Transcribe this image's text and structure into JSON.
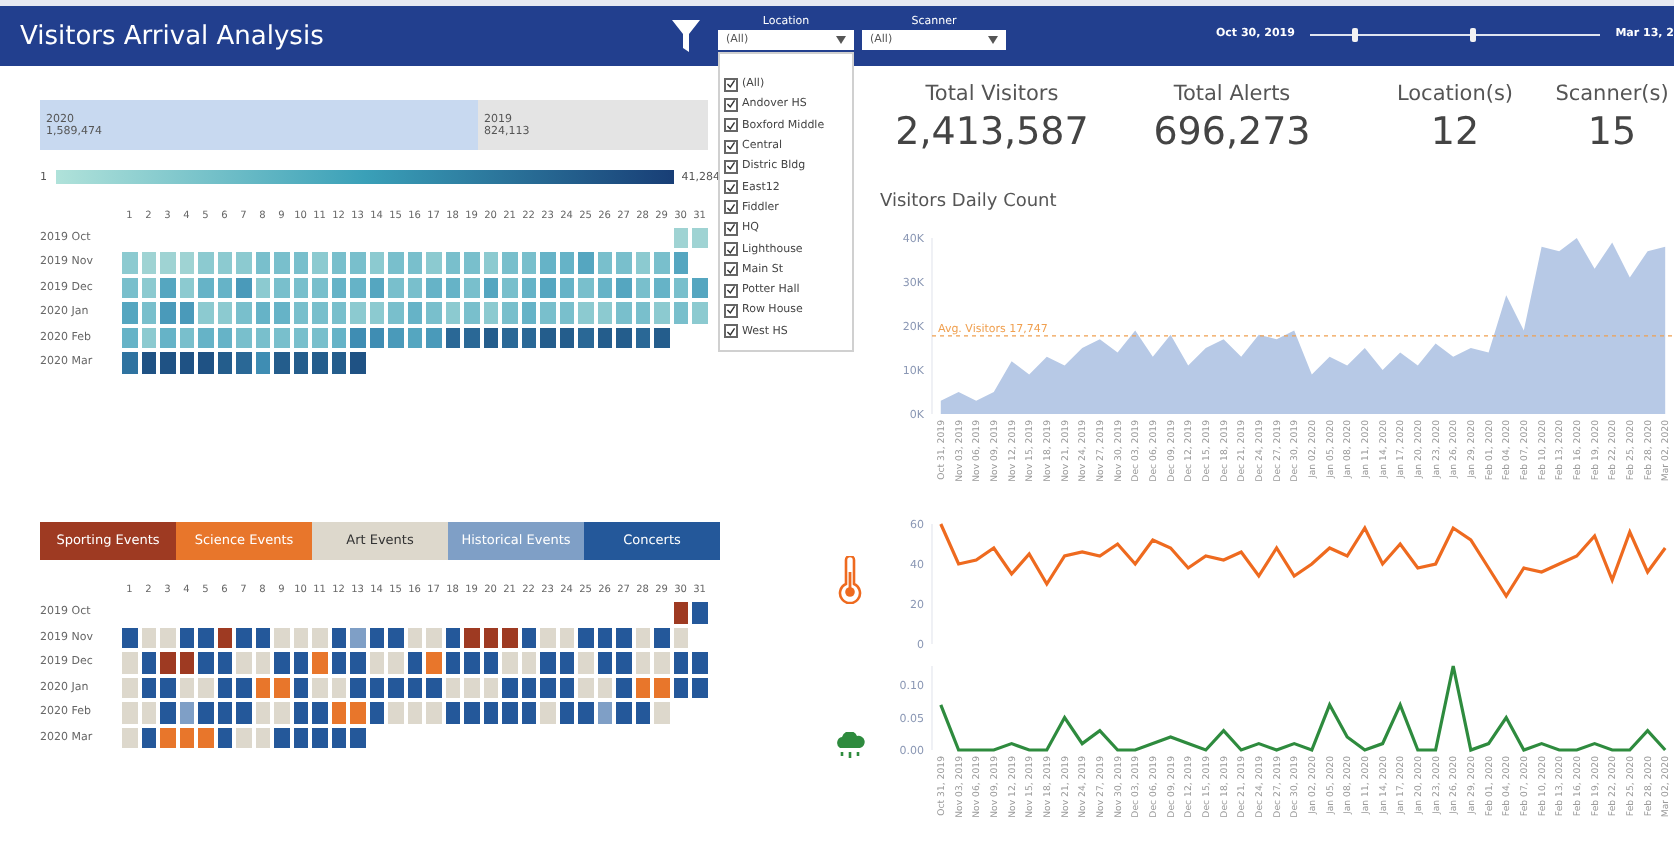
{
  "header": {
    "title": "Visitors Arrival Analysis",
    "location_filter": {
      "label": "Location",
      "value": "(All)",
      "options": [
        {
          "label": "(All)",
          "checked": true
        },
        {
          "label": "Andover HS",
          "checked": true
        },
        {
          "label": "Boxford Middle",
          "checked": true
        },
        {
          "label": "Central",
          "checked": true
        },
        {
          "label": "Distric Bldg",
          "checked": true
        },
        {
          "label": "East12",
          "checked": true
        },
        {
          "label": "Fiddler",
          "checked": true
        },
        {
          "label": "HQ",
          "checked": true
        },
        {
          "label": "Lighthouse",
          "checked": true
        },
        {
          "label": "Main St",
          "checked": true
        },
        {
          "label": "Potter Hall",
          "checked": true
        },
        {
          "label": "Row House",
          "checked": true
        },
        {
          "label": "West HS",
          "checked": true
        }
      ]
    },
    "scanner_filter": {
      "label": "Scanner",
      "value": "(All)"
    },
    "date_range": {
      "start": "Oct 30, 2019",
      "end": "Mar 13, 2",
      "thumbs": [
        {
          "level": 0.14
        },
        {
          "level": 0.55
        }
      ]
    }
  },
  "year_totals": [
    {
      "year": "2020",
      "total": "1,589,474"
    },
    {
      "year": "2019",
      "total": "824,113"
    }
  ],
  "color_scale": {
    "min": "1",
    "max": "41,284"
  },
  "visitors_heatmap": {
    "day_labels": [
      "1",
      "2",
      "3",
      "4",
      "5",
      "6",
      "7",
      "8",
      "9",
      "10",
      "11",
      "12",
      "13",
      "14",
      "15",
      "16",
      "17",
      "18",
      "19",
      "20",
      "21",
      "22",
      "23",
      "24",
      "25",
      "26",
      "27",
      "28",
      "29",
      "30",
      "31"
    ],
    "rows": [
      {
        "month": "2019 Oct",
        "cells": [
          null,
          null,
          null,
          null,
          null,
          null,
          null,
          null,
          null,
          null,
          null,
          null,
          null,
          null,
          null,
          null,
          null,
          null,
          null,
          null,
          null,
          null,
          null,
          null,
          null,
          null,
          null,
          null,
          null,
          {
            "color": "#9fd3d3"
          },
          {
            "color": "#9fd3d3"
          }
        ]
      },
      {
        "month": "2019 Nov",
        "cells": [
          {
            "color": "#8ccad0"
          },
          {
            "color": "#9fd3d3"
          },
          {
            "color": "#9fd3d3"
          },
          {
            "color": "#9fd3d3"
          },
          {
            "color": "#8ccad0"
          },
          {
            "color": "#8ccad0"
          },
          {
            "color": "#8ccad0"
          },
          {
            "color": "#79bfcc"
          },
          {
            "color": "#79bfcc"
          },
          {
            "color": "#79bfcc"
          },
          {
            "color": "#8ccad0"
          },
          {
            "color": "#79bfcc"
          },
          {
            "color": "#79bfcc"
          },
          {
            "color": "#8ccad0"
          },
          {
            "color": "#79bfcc"
          },
          {
            "color": "#79bfcc"
          },
          {
            "color": "#8ccad0"
          },
          {
            "color": "#79bfcc"
          },
          {
            "color": "#79bfcc"
          },
          {
            "color": "#8ccad0"
          },
          {
            "color": "#79bfcc"
          },
          {
            "color": "#79bfcc"
          },
          {
            "color": "#66b3c7"
          },
          {
            "color": "#66b3c7"
          },
          {
            "color": "#55a6c0"
          },
          {
            "color": "#79bfcc"
          },
          {
            "color": "#79bfcc"
          },
          {
            "color": "#8ccad0"
          },
          {
            "color": "#79bfcc"
          },
          {
            "color": "#55a6c0"
          }
        ]
      },
      {
        "month": "2019 Dec",
        "cells": [
          {
            "color": "#79bfcc"
          },
          {
            "color": "#8ccad0"
          },
          {
            "color": "#55a6c0"
          },
          {
            "color": "#8ccad0"
          },
          {
            "color": "#66b3c7"
          },
          {
            "color": "#66b3c7"
          },
          {
            "color": "#4a9aba"
          },
          {
            "color": "#8ccad0"
          },
          {
            "color": "#79bfcc"
          },
          {
            "color": "#79bfcc"
          },
          {
            "color": "#79bfcc"
          },
          {
            "color": "#66b3c7"
          },
          {
            "color": "#66b3c7"
          },
          {
            "color": "#55a6c0"
          },
          {
            "color": "#79bfcc"
          },
          {
            "color": "#79bfcc"
          },
          {
            "color": "#66b3c7"
          },
          {
            "color": "#66b3c7"
          },
          {
            "color": "#79bfcc"
          },
          {
            "color": "#55a6c0"
          },
          {
            "color": "#79bfcc"
          },
          {
            "color": "#66b3c7"
          },
          {
            "color": "#55a6c0"
          },
          {
            "color": "#66b3c7"
          },
          {
            "color": "#79bfcc"
          },
          {
            "color": "#66b3c7"
          },
          {
            "color": "#55a6c0"
          },
          {
            "color": "#79bfcc"
          },
          {
            "color": "#66b3c7"
          },
          {
            "color": "#79bfcc"
          },
          {
            "color": "#55a6c0"
          }
        ]
      },
      {
        "month": "2020 Jan",
        "cells": [
          {
            "color": "#55a6c0"
          },
          {
            "color": "#79bfcc"
          },
          {
            "color": "#4a9aba"
          },
          {
            "color": "#4a9aba"
          },
          {
            "color": "#8ccad0"
          },
          {
            "color": "#8ccad0"
          },
          {
            "color": "#79bfcc"
          },
          {
            "color": "#66b3c7"
          },
          {
            "color": "#66b3c7"
          },
          {
            "color": "#79bfcc"
          },
          {
            "color": "#79bfcc"
          },
          {
            "color": "#79bfcc"
          },
          {
            "color": "#8ccad0"
          },
          {
            "color": "#8ccad0"
          },
          {
            "color": "#79bfcc"
          },
          {
            "color": "#66b3c7"
          },
          {
            "color": "#79bfcc"
          },
          {
            "color": "#8ccad0"
          },
          {
            "color": "#79bfcc"
          },
          {
            "color": "#8ccad0"
          },
          {
            "color": "#79bfcc"
          },
          {
            "color": "#66b3c7"
          },
          {
            "color": "#79bfcc"
          },
          {
            "color": "#79bfcc"
          },
          {
            "color": "#8ccad0"
          },
          {
            "color": "#8ccad0"
          },
          {
            "color": "#79bfcc"
          },
          {
            "color": "#79bfcc"
          },
          {
            "color": "#8ccad0"
          },
          {
            "color": "#79bfcc"
          },
          {
            "color": "#8ccad0"
          }
        ]
      },
      {
        "month": "2020 Feb",
        "cells": [
          {
            "color": "#66b3c7"
          },
          {
            "color": "#8ccad0"
          },
          {
            "color": "#66b3c7"
          },
          {
            "color": "#79bfcc"
          },
          {
            "color": "#66b3c7"
          },
          {
            "color": "#66b3c7"
          },
          {
            "color": "#79bfcc"
          },
          {
            "color": "#79bfcc"
          },
          {
            "color": "#79bfcc"
          },
          {
            "color": "#79bfcc"
          },
          {
            "color": "#79bfcc"
          },
          {
            "color": "#66b3c7"
          },
          {
            "color": "#3f8db3"
          },
          {
            "color": "#3f8db3"
          },
          {
            "color": "#4a9aba"
          },
          {
            "color": "#55a6c0"
          },
          {
            "color": "#4a9aba"
          },
          {
            "color": "#2a6896"
          },
          {
            "color": "#2a6896"
          },
          {
            "color": "#245d8c"
          },
          {
            "color": "#2a6896"
          },
          {
            "color": "#2a6896"
          },
          {
            "color": "#245d8c"
          },
          {
            "color": "#245d8c"
          },
          {
            "color": "#2a6896"
          },
          {
            "color": "#245d8c"
          },
          {
            "color": "#245d8c"
          },
          {
            "color": "#2a6896"
          },
          {
            "color": "#245d8c"
          }
        ]
      },
      {
        "month": "2020 Mar",
        "cells": [
          {
            "color": "#2f73a0"
          },
          {
            "color": "#1f5284"
          },
          {
            "color": "#1f5284"
          },
          {
            "color": "#1f5284"
          },
          {
            "color": "#1f5284"
          },
          {
            "color": "#245d8c"
          },
          {
            "color": "#2a6896"
          },
          {
            "color": "#3f8db3"
          },
          {
            "color": "#245d8c"
          },
          {
            "color": "#245d8c"
          },
          {
            "color": "#245d8c"
          },
          {
            "color": "#245d8c"
          },
          {
            "color": "#1f5284"
          }
        ]
      }
    ]
  },
  "events": {
    "legend": [
      {
        "label": "Sporting Events",
        "color": "#9e3a22"
      },
      {
        "label": "Science Events",
        "color": "#e8762b"
      },
      {
        "label": "Art Events",
        "color": "#ddd8cc"
      },
      {
        "label": "Historical Events",
        "color": "#7f9fc6"
      },
      {
        "label": "Concerts",
        "color": "#24589a"
      }
    ],
    "day_labels": [
      "1",
      "2",
      "3",
      "4",
      "5",
      "6",
      "7",
      "8",
      "9",
      "10",
      "11",
      "12",
      "13",
      "14",
      "15",
      "16",
      "17",
      "18",
      "19",
      "20",
      "21",
      "22",
      "23",
      "24",
      "25",
      "26",
      "27",
      "28",
      "29",
      "30",
      "31"
    ],
    "rows": [
      {
        "month": "2019 Oct",
        "cells": [
          null,
          null,
          null,
          null,
          null,
          null,
          null,
          null,
          null,
          null,
          null,
          null,
          null,
          null,
          null,
          null,
          null,
          null,
          null,
          null,
          null,
          null,
          null,
          null,
          null,
          null,
          null,
          null,
          null,
          {
            "color": "#9e3a22"
          },
          {
            "color": "#24589a"
          }
        ]
      },
      {
        "month": "2019 Nov",
        "cells": [
          {
            "color": "#24589a"
          },
          {
            "color": "#ddd8cc"
          },
          {
            "color": "#ddd8cc"
          },
          {
            "color": "#24589a"
          },
          {
            "color": "#24589a"
          },
          {
            "color": "#9e3a22"
          },
          {
            "color": "#24589a"
          },
          {
            "color": "#24589a"
          },
          {
            "color": "#ddd8cc"
          },
          {
            "color": "#ddd8cc"
          },
          {
            "color": "#ddd8cc"
          },
          {
            "color": "#24589a"
          },
          {
            "color": "#7f9fc6"
          },
          {
            "color": "#24589a"
          },
          {
            "color": "#24589a"
          },
          {
            "color": "#ddd8cc"
          },
          {
            "color": "#ddd8cc"
          },
          {
            "color": "#24589a"
          },
          {
            "color": "#9e3a22"
          },
          {
            "color": "#9e3a22"
          },
          {
            "color": "#9e3a22"
          },
          {
            "color": "#24589a"
          },
          {
            "color": "#ddd8cc"
          },
          {
            "color": "#ddd8cc"
          },
          {
            "color": "#24589a"
          },
          {
            "color": "#24589a"
          },
          {
            "color": "#24589a"
          },
          {
            "color": "#ddd8cc"
          },
          {
            "color": "#24589a"
          },
          {
            "color": "#ddd8cc"
          }
        ]
      },
      {
        "month": "2019 Dec",
        "cells": [
          {
            "color": "#ddd8cc"
          },
          {
            "color": "#24589a"
          },
          {
            "color": "#9e3a22"
          },
          {
            "color": "#9e3a22"
          },
          {
            "color": "#24589a"
          },
          {
            "color": "#24589a"
          },
          {
            "color": "#ddd8cc"
          },
          {
            "color": "#ddd8cc"
          },
          {
            "color": "#24589a"
          },
          {
            "color": "#24589a"
          },
          {
            "color": "#e8762b"
          },
          {
            "color": "#24589a"
          },
          {
            "color": "#24589a"
          },
          {
            "color": "#ddd8cc"
          },
          {
            "color": "#ddd8cc"
          },
          {
            "color": "#24589a"
          },
          {
            "color": "#e8762b"
          },
          {
            "color": "#24589a"
          },
          {
            "color": "#24589a"
          },
          {
            "color": "#24589a"
          },
          {
            "color": "#ddd8cc"
          },
          {
            "color": "#ddd8cc"
          },
          {
            "color": "#24589a"
          },
          {
            "color": "#24589a"
          },
          {
            "color": "#ddd8cc"
          },
          {
            "color": "#24589a"
          },
          {
            "color": "#24589a"
          },
          {
            "color": "#ddd8cc"
          },
          {
            "color": "#ddd8cc"
          },
          {
            "color": "#24589a"
          },
          {
            "color": "#24589a"
          }
        ]
      },
      {
        "month": "2020 Jan",
        "cells": [
          {
            "color": "#ddd8cc"
          },
          {
            "color": "#24589a"
          },
          {
            "color": "#24589a"
          },
          {
            "color": "#ddd8cc"
          },
          {
            "color": "#ddd8cc"
          },
          {
            "color": "#24589a"
          },
          {
            "color": "#24589a"
          },
          {
            "color": "#e8762b"
          },
          {
            "color": "#e8762b"
          },
          {
            "color": "#24589a"
          },
          {
            "color": "#ddd8cc"
          },
          {
            "color": "#ddd8cc"
          },
          {
            "color": "#24589a"
          },
          {
            "color": "#24589a"
          },
          {
            "color": "#24589a"
          },
          {
            "color": "#24589a"
          },
          {
            "color": "#24589a"
          },
          {
            "color": "#ddd8cc"
          },
          {
            "color": "#ddd8cc"
          },
          {
            "color": "#ddd8cc"
          },
          {
            "color": "#24589a"
          },
          {
            "color": "#24589a"
          },
          {
            "color": "#24589a"
          },
          {
            "color": "#24589a"
          },
          {
            "color": "#ddd8cc"
          },
          {
            "color": "#ddd8cc"
          },
          {
            "color": "#24589a"
          },
          {
            "color": "#e8762b"
          },
          {
            "color": "#e8762b"
          },
          {
            "color": "#24589a"
          },
          {
            "color": "#24589a"
          }
        ]
      },
      {
        "month": "2020 Feb",
        "cells": [
          {
            "color": "#ddd8cc"
          },
          {
            "color": "#ddd8cc"
          },
          {
            "color": "#24589a"
          },
          {
            "color": "#7f9fc6"
          },
          {
            "color": "#24589a"
          },
          {
            "color": "#24589a"
          },
          {
            "color": "#24589a"
          },
          {
            "color": "#ddd8cc"
          },
          {
            "color": "#ddd8cc"
          },
          {
            "color": "#24589a"
          },
          {
            "color": "#24589a"
          },
          {
            "color": "#e8762b"
          },
          {
            "color": "#e8762b"
          },
          {
            "color": "#24589a"
          },
          {
            "color": "#ddd8cc"
          },
          {
            "color": "#ddd8cc"
          },
          {
            "color": "#ddd8cc"
          },
          {
            "color": "#24589a"
          },
          {
            "color": "#24589a"
          },
          {
            "color": "#24589a"
          },
          {
            "color": "#24589a"
          },
          {
            "color": "#24589a"
          },
          {
            "color": "#ddd8cc"
          },
          {
            "color": "#24589a"
          },
          {
            "color": "#24589a"
          },
          {
            "color": "#7f9fc6"
          },
          {
            "color": "#24589a"
          },
          {
            "color": "#24589a"
          },
          {
            "color": "#ddd8cc"
          }
        ]
      },
      {
        "month": "2020 Mar",
        "cells": [
          {
            "color": "#ddd8cc"
          },
          {
            "color": "#24589a"
          },
          {
            "color": "#e8762b"
          },
          {
            "color": "#e8762b"
          },
          {
            "color": "#e8762b"
          },
          {
            "color": "#24589a"
          },
          {
            "color": "#ddd8cc"
          },
          {
            "color": "#ddd8cc"
          },
          {
            "color": "#24589a"
          },
          {
            "color": "#24589a"
          },
          {
            "color": "#24589a"
          },
          {
            "color": "#24589a"
          },
          {
            "color": "#24589a"
          }
        ]
      }
    ]
  },
  "kpis": [
    {
      "label": "Total Visitors",
      "value": "2,413,587"
    },
    {
      "label": "Total Alerts",
      "value": "696,273"
    },
    {
      "label": "Location(s)",
      "value": "12"
    },
    {
      "label": "Scanner(s)",
      "value": "15"
    }
  ],
  "visitors_daily": {
    "title": "Visitors Daily Count",
    "chart_data": {
      "type": "area",
      "categories": [
        "Oct 31, 2019",
        "Nov 03, 2019",
        "Nov 06, 2019",
        "Nov 09, 2019",
        "Nov 12, 2019",
        "Nov 15, 2019",
        "Nov 18, 2019",
        "Nov 21, 2019",
        "Nov 24, 2019",
        "Nov 27, 2019",
        "Nov 30, 2019",
        "Dec 03, 2019",
        "Dec 06, 2019",
        "Dec 09, 2019",
        "Dec 12, 2019",
        "Dec 15, 2019",
        "Dec 18, 2019",
        "Dec 21, 2019",
        "Dec 24, 2019",
        "Dec 27, 2019",
        "Dec 30, 2019",
        "Jan 02, 2020",
        "Jan 05, 2020",
        "Jan 08, 2020",
        "Jan 11, 2020",
        "Jan 14, 2020",
        "Jan 17, 2020",
        "Jan 20, 2020",
        "Jan 23, 2020",
        "Jan 26, 2020",
        "Jan 29, 2020",
        "Feb 01, 2020",
        "Feb 04, 2020",
        "Feb 07, 2020",
        "Feb 10, 2020",
        "Feb 13, 2020",
        "Feb 16, 2020",
        "Feb 19, 2020",
        "Feb 22, 2020",
        "Feb 25, 2020",
        "Feb 28, 2020",
        "Mar 02, 2020"
      ],
      "series": [
        {
          "color": "#b7c9e6",
          "values": [
            3000,
            5000,
            3000,
            5000,
            12000,
            9000,
            13000,
            11000,
            15000,
            17000,
            14000,
            19000,
            13000,
            18000,
            11000,
            15000,
            17000,
            13000,
            18000,
            17000,
            19000,
            9000,
            13000,
            11000,
            15000,
            10000,
            14000,
            11000,
            16000,
            13000,
            15000,
            14000,
            27000,
            19000,
            38000,
            37000,
            40000,
            33000,
            39000,
            31000,
            37000,
            38000
          ]
        }
      ],
      "ylim": [
        0,
        40000
      ],
      "yticks": [
        {
          "value": 0,
          "label": "0K"
        },
        {
          "value": 10000,
          "label": "10K"
        },
        {
          "value": 20000,
          "label": "20K"
        },
        {
          "value": 30000,
          "label": "30K"
        },
        {
          "value": 40000,
          "label": "40K"
        }
      ],
      "ref_lines": [
        {
          "axis": "y",
          "value": 17747,
          "label": "Avg. Visitors 17,747",
          "color": "#f0a050"
        }
      ]
    }
  },
  "temperature": {
    "chart_data": {
      "type": "line",
      "series": [
        {
          "color": "#ee6a1f",
          "values": [
            60,
            40,
            42,
            48,
            35,
            45,
            30,
            44,
            46,
            44,
            50,
            40,
            52,
            48,
            38,
            44,
            42,
            46,
            34,
            48,
            34,
            40,
            48,
            44,
            58,
            40,
            50,
            38,
            40,
            58,
            52,
            38,
            24,
            38,
            36,
            40,
            44,
            54,
            32,
            56,
            36,
            48
          ]
        }
      ],
      "ylim": [
        0,
        60
      ],
      "yticks": [
        0,
        20,
        40,
        60
      ]
    }
  },
  "precipitation": {
    "chart_data": {
      "type": "line",
      "categories": [
        "Oct 31, 2019",
        "Nov 03, 2019",
        "Nov 06, 2019",
        "Nov 09, 2019",
        "Nov 12, 2019",
        "Nov 15, 2019",
        "Nov 18, 2019",
        "Nov 21, 2019",
        "Nov 24, 2019",
        "Nov 27, 2019",
        "Nov 30, 2019",
        "Dec 03, 2019",
        "Dec 06, 2019",
        "Dec 09, 2019",
        "Dec 12, 2019",
        "Dec 15, 2019",
        "Dec 18, 2019",
        "Dec 21, 2019",
        "Dec 24, 2019",
        "Dec 27, 2019",
        "Dec 30, 2019",
        "Jan 02, 2020",
        "Jan 05, 2020",
        "Jan 08, 2020",
        "Jan 11, 2020",
        "Jan 14, 2020",
        "Jan 17, 2020",
        "Jan 20, 2020",
        "Jan 23, 2020",
        "Jan 26, 2020",
        "Jan 29, 2020",
        "Feb 01, 2020",
        "Feb 04, 2020",
        "Feb 07, 2020",
        "Feb 10, 2020",
        "Feb 13, 2020",
        "Feb 16, 2020",
        "Feb 19, 2020",
        "Feb 22, 2020",
        "Feb 25, 2020",
        "Feb 28, 2020",
        "Mar 02, 2020"
      ],
      "series": [
        {
          "color": "#2e8b3e",
          "values": [
            0.07,
            0,
            0,
            0,
            0.01,
            0,
            0,
            0.05,
            0.01,
            0.03,
            0,
            0,
            0.01,
            0.02,
            0.01,
            0,
            0.03,
            0,
            0.01,
            0,
            0.01,
            0,
            0.07,
            0.02,
            0,
            0.01,
            0.07,
            0,
            0,
            0.13,
            0,
            0.01,
            0.05,
            0,
            0.01,
            0,
            0,
            0.01,
            0,
            0,
            0.03,
            0
          ]
        }
      ],
      "ylim": [
        0,
        0.13
      ],
      "yticks": [
        {
          "value": 0,
          "label": "0.00"
        },
        {
          "value": 0.05,
          "label": "0.05"
        },
        {
          "value": 0.1,
          "label": "0.10"
        }
      ]
    }
  }
}
